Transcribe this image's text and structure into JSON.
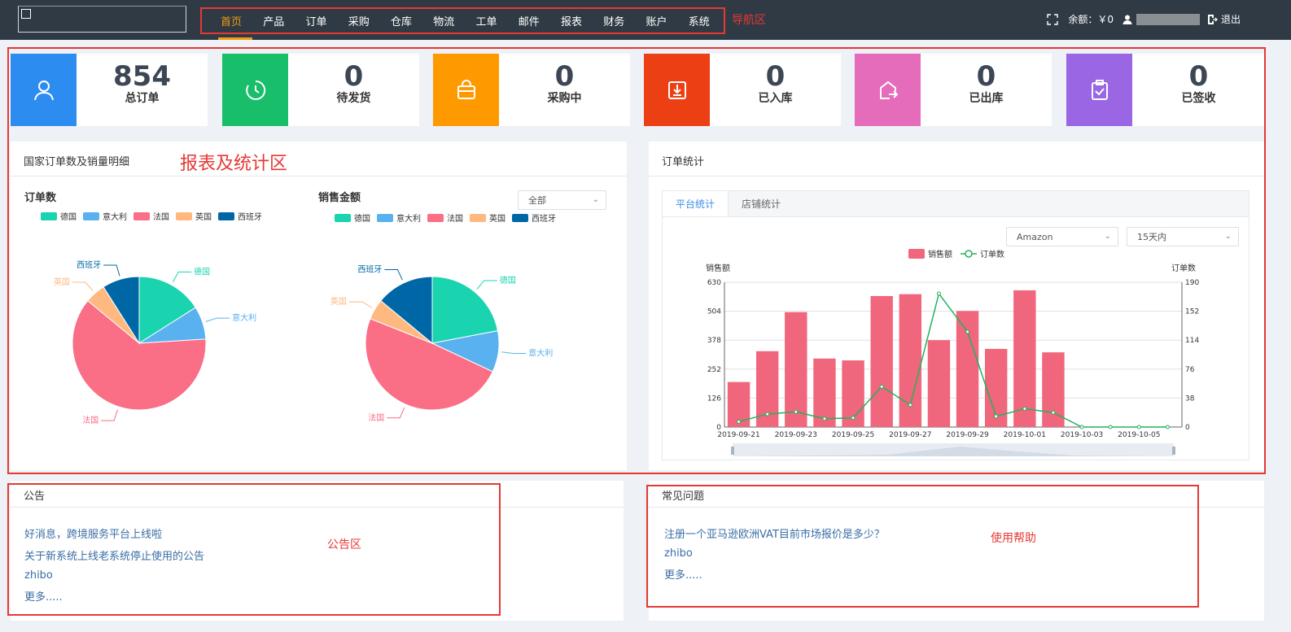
{
  "nav": {
    "items": [
      "首页",
      "产品",
      "订单",
      "采购",
      "仓库",
      "物流",
      "工单",
      "邮件",
      "报表",
      "财务",
      "账户",
      "系统"
    ],
    "annotation": "导航区"
  },
  "top": {
    "balance": "余额：￥0",
    "logout": "退出"
  },
  "cards": [
    {
      "value": "854",
      "label": "总订单",
      "color": "#2d8cf0",
      "icon": "user-icon"
    },
    {
      "value": "0",
      "label": "待发货",
      "color": "#19be6b",
      "icon": "clock-icon"
    },
    {
      "value": "0",
      "label": "采购中",
      "color": "#ff9900",
      "icon": "shopping-bag-icon"
    },
    {
      "value": "0",
      "label": "已入库",
      "color": "#ed3f14",
      "icon": "download-icon"
    },
    {
      "value": "0",
      "label": "已出库",
      "color": "#e46cbb",
      "icon": "export-icon"
    },
    {
      "value": "0",
      "label": "已签收",
      "color": "#9a66e4",
      "icon": "clipboard-check-icon"
    }
  ],
  "left_panel": {
    "title": "国家订单数及销量明细",
    "annotation": "报表及统计区",
    "orders_title": "订单数",
    "sales_title": "销售金额",
    "filter_value": "全部"
  },
  "right_panel": {
    "title": "订单统计",
    "tabs": [
      "平台统计",
      "店铺统计"
    ],
    "platform_value": "Amazon",
    "range_value": "15天内"
  },
  "notice": {
    "title": "公告",
    "annotation": "公告区",
    "links": [
      "好消息，跨境服务平台上线啦",
      "关于新系统上线老系统停止使用的公告",
      "zhibo",
      "更多....."
    ]
  },
  "faq": {
    "title": "常见问题",
    "annotation": "使用帮助",
    "links": [
      "注册一个亚马逊欧洲VAT目前市场报价是多少？",
      "zhibo",
      "更多....."
    ]
  },
  "colors": {
    "germany": "#19d4ae",
    "italy": "#5ab1ef",
    "france": "#fa6e86",
    "uk": "#ffb980",
    "spain": "#0067a6",
    "bar": "#f0667c",
    "line": "#22b35e"
  },
  "chart_data": [
    {
      "type": "pie",
      "title": "订单数",
      "categories": [
        "德国",
        "意大利",
        "法国",
        "英国",
        "西班牙"
      ],
      "values": [
        16,
        8,
        62,
        5,
        9
      ]
    },
    {
      "type": "pie",
      "title": "销售金额",
      "categories": [
        "德国",
        "意大利",
        "法国",
        "英国",
        "西班牙"
      ],
      "values": [
        22,
        10,
        49,
        5,
        14
      ]
    },
    {
      "type": "bar",
      "series": [
        {
          "name": "销售额",
          "type": "bar",
          "values": [
            196,
            330,
            500,
            298,
            290,
            570,
            578,
            378,
            505,
            340,
            595,
            325,
            0,
            0,
            0,
            0
          ]
        },
        {
          "name": "订单数",
          "type": "line",
          "values": [
            7,
            17,
            20,
            11,
            12,
            53,
            29,
            175,
            125,
            14,
            24,
            19,
            0,
            0,
            0,
            0
          ]
        }
      ],
      "x": [
        "2019-09-21",
        "2019-09-22",
        "2019-09-23",
        "2019-09-24",
        "2019-09-25",
        "2019-09-26",
        "2019-09-27",
        "2019-09-28",
        "2019-09-29",
        "2019-09-30",
        "2019-10-01",
        "2019-10-02",
        "2019-10-03",
        "2019-10-04",
        "2019-10-05",
        "2019-10-06"
      ],
      "xticks": [
        "2019-09-21",
        "2019-09-23",
        "2019-09-25",
        "2019-09-27",
        "2019-09-29",
        "2019-10-01",
        "2019-10-03",
        "2019-10-05"
      ],
      "ylabel": "销售额",
      "y2label": "订单数",
      "ylim": [
        0,
        630
      ],
      "yticks": [
        0,
        126,
        252,
        378,
        504,
        630
      ],
      "y2lim": [
        0,
        190
      ],
      "y2ticks": [
        0,
        38,
        76,
        114,
        152,
        190
      ],
      "legend": "top-center",
      "grid": true
    }
  ]
}
